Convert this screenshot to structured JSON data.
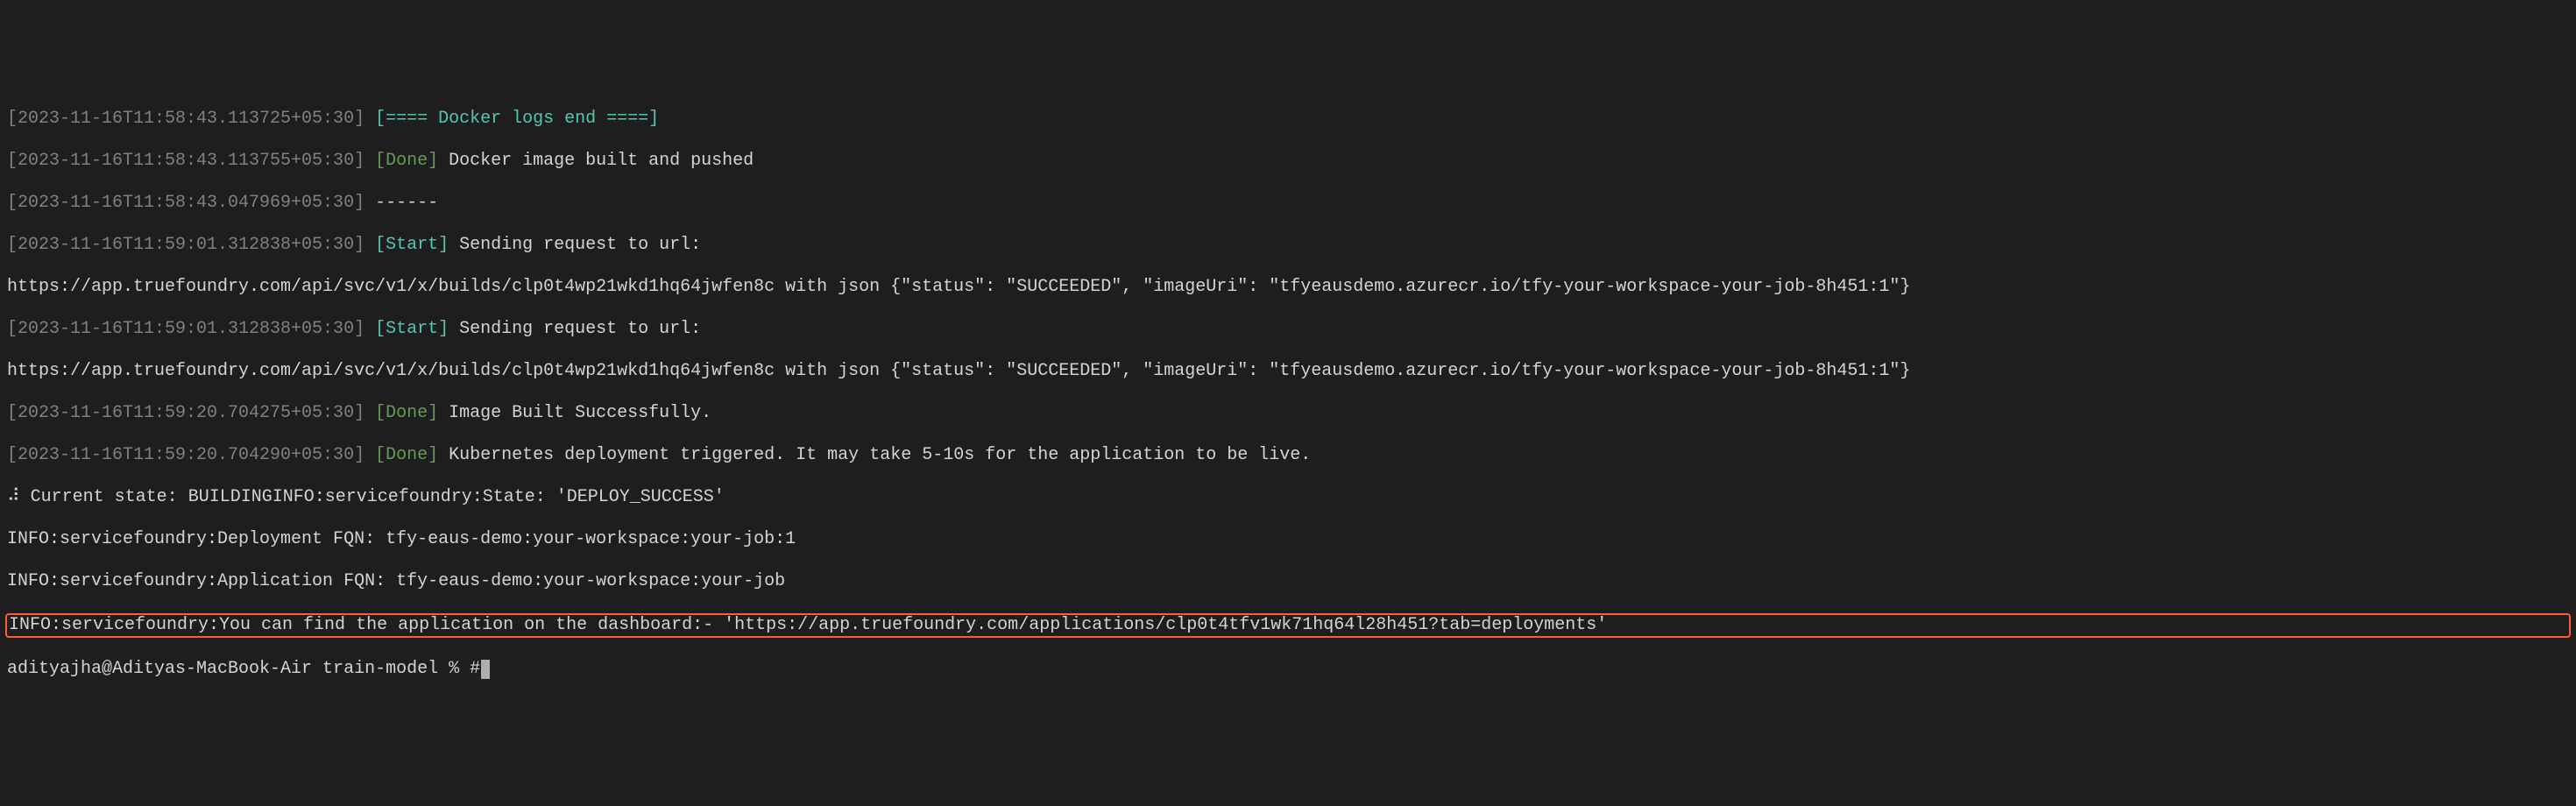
{
  "lines": [
    {
      "ts": "[2023-11-16T11:58:43.113725+05:30]",
      "tag": "[==== Docker logs end ====]",
      "tagClass": "cyan",
      "rest": ""
    },
    {
      "ts": "[2023-11-16T11:58:43.113755+05:30]",
      "tag": "[Done]",
      "tagClass": "green",
      "rest": " Docker image built and pushed"
    },
    {
      "ts": "[2023-11-16T11:58:43.047969+05:30]",
      "tag": "",
      "tagClass": "",
      "rest": " ------"
    },
    {
      "ts": "[2023-11-16T11:59:01.312838+05:30]",
      "tag": "[Start]",
      "tagClass": "cyan",
      "rest": " Sending request to url:"
    }
  ],
  "url1": "https://app.truefoundry.com/api/svc/v1/x/builds/clp0t4wp21wkd1hq64jwfen8c with json {\"status\": \"SUCCEEDED\", \"imageUri\": \"tfyeausdemo.azurecr.io/tfy-your-workspace-your-job-8h451:1\"}",
  "line5": {
    "ts": "[2023-11-16T11:59:01.312838+05:30]",
    "tag": "[Start]",
    "tagClass": "cyan",
    "rest": " Sending request to url:"
  },
  "url2": "https://app.truefoundry.com/api/svc/v1/x/builds/clp0t4wp21wkd1hq64jwfen8c with json {\"status\": \"SUCCEEDED\", \"imageUri\": \"tfyeausdemo.azurecr.io/tfy-your-workspace-your-job-8h451:1\"}",
  "line7": {
    "ts": "[2023-11-16T11:59:20.704275+05:30]",
    "tag": "[Done]",
    "tagClass": "green",
    "rest": " Image Built Successfully."
  },
  "line8": {
    "ts": "[2023-11-16T11:59:20.704290+05:30]",
    "tag": "[Done]",
    "tagClass": "green",
    "rest": " Kubernetes deployment triggered. It may take 5-10s for the application to be live."
  },
  "spinner": "⠼",
  "stateLine": " Current state: BUILDINGINFO:servicefoundry:State: 'DEPLOY_SUCCESS'",
  "infoFqn": "INFO:servicefoundry:Deployment FQN: tfy-eaus-demo:your-workspace:your-job:1",
  "infoApp": "INFO:servicefoundry:Application FQN: tfy-eaus-demo:your-workspace:your-job",
  "highlighted": "INFO:servicefoundry:You can find the application on the dashboard:- 'https://app.truefoundry.com/applications/clp0t4tfv1wk71hq64l28h451?tab=deployments'",
  "prompt": "adityajha@Adityas-MacBook-Air train-model % #"
}
